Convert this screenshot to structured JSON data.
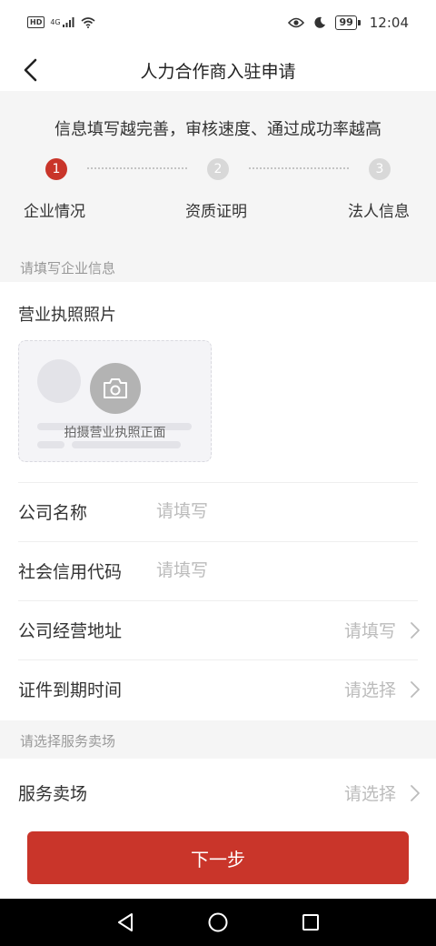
{
  "status_bar": {
    "hd_badge": "HD",
    "network": "4G",
    "battery": "99",
    "time": "12:04"
  },
  "header": {
    "title": "人力合作商入驻申请",
    "back_icon": "back-arrow-icon"
  },
  "tip": "信息填写越完善，审核速度、通过成功率越高",
  "steps": [
    {
      "number": "1",
      "label": "企业情况",
      "active": true
    },
    {
      "number": "2",
      "label": "资质证明",
      "active": false
    },
    {
      "number": "3",
      "label": "法人信息",
      "active": false
    }
  ],
  "company_section": {
    "header": "请填写企业信息",
    "license_title": "营业执照照片",
    "upload_text": "拍摄营业执照正面",
    "fields": [
      {
        "label": "公司名称",
        "placeholder": "请填写",
        "type": "input"
      },
      {
        "label": "社会信用代码",
        "placeholder": "请填写",
        "type": "input"
      },
      {
        "label": "公司经营地址",
        "value": "请填写",
        "type": "select"
      },
      {
        "label": "证件到期时间",
        "value": "请选择",
        "type": "select"
      }
    ]
  },
  "service_section": {
    "header": "请选择服务卖场",
    "field": {
      "label": "服务卖场",
      "value": "请选择",
      "type": "select"
    }
  },
  "next_button": "下一步",
  "colors": {
    "accent": "#c9352a",
    "inactive_step": "#d8d8d8",
    "placeholder": "#bbbbbb"
  }
}
